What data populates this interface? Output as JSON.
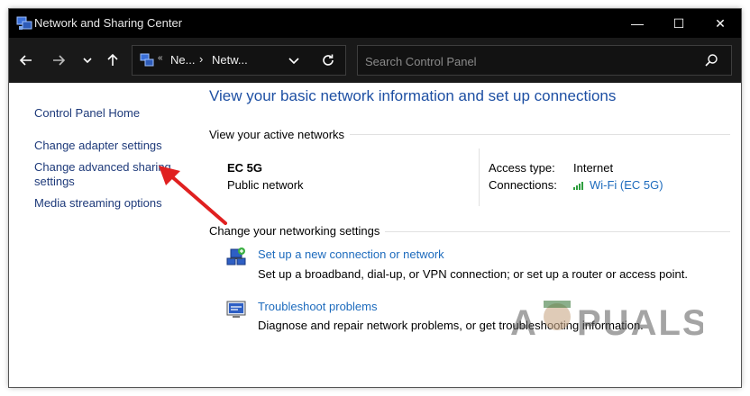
{
  "window": {
    "title": "Network and Sharing Center",
    "controls": {
      "minimize": "—",
      "maximize": "☐",
      "close": "✕"
    }
  },
  "navigation": {
    "back_icon": "arrow-left-icon",
    "forward_icon": "arrow-right-icon",
    "recent_icon": "chevron-down-icon",
    "up_icon": "arrow-up-icon",
    "address": {
      "icon": "network-folder-icon",
      "separator": "«",
      "crumbs": [
        "Ne...",
        "Netw..."
      ],
      "crumb_separator": "›"
    },
    "refresh_icon": "refresh-icon"
  },
  "search": {
    "placeholder": "Search Control Panel",
    "value": "",
    "icon": "search-icon"
  },
  "sidebar": {
    "items": [
      {
        "label": "Control Panel Home"
      },
      {
        "label": "Change adapter settings"
      },
      {
        "label_line1": "Change advanced sharing",
        "label_line2": "settings"
      },
      {
        "label": "Media streaming options"
      }
    ]
  },
  "main": {
    "title": "View your basic network information and set up connections",
    "active_networks": {
      "heading": "View your active networks",
      "network_name": "EC 5G",
      "network_category": "Public network",
      "access_type_label": "Access type:",
      "access_type_value": "Internet",
      "connections_label": "Connections:",
      "connections_value": "Wi-Fi (EC 5G)"
    },
    "networking_settings": {
      "heading": "Change your networking settings",
      "tasks": [
        {
          "icon": "new-connection-icon",
          "link": "Set up a new connection or network",
          "description": "Set up a broadband, dial-up, or VPN connection; or set up a router or access point."
        },
        {
          "icon": "troubleshoot-icon",
          "link": "Troubleshoot problems",
          "description": "Diagnose and repair network problems, or get troubleshooting information."
        }
      ]
    }
  },
  "watermark": {
    "text": "APPUALS"
  },
  "colors": {
    "titlebar": "#000000",
    "navbar": "#191919",
    "link": "#1d6bbd",
    "sidebar_link": "#1e3a7a",
    "title_blue": "#1d4fa3",
    "annotation_red": "#e02020"
  }
}
